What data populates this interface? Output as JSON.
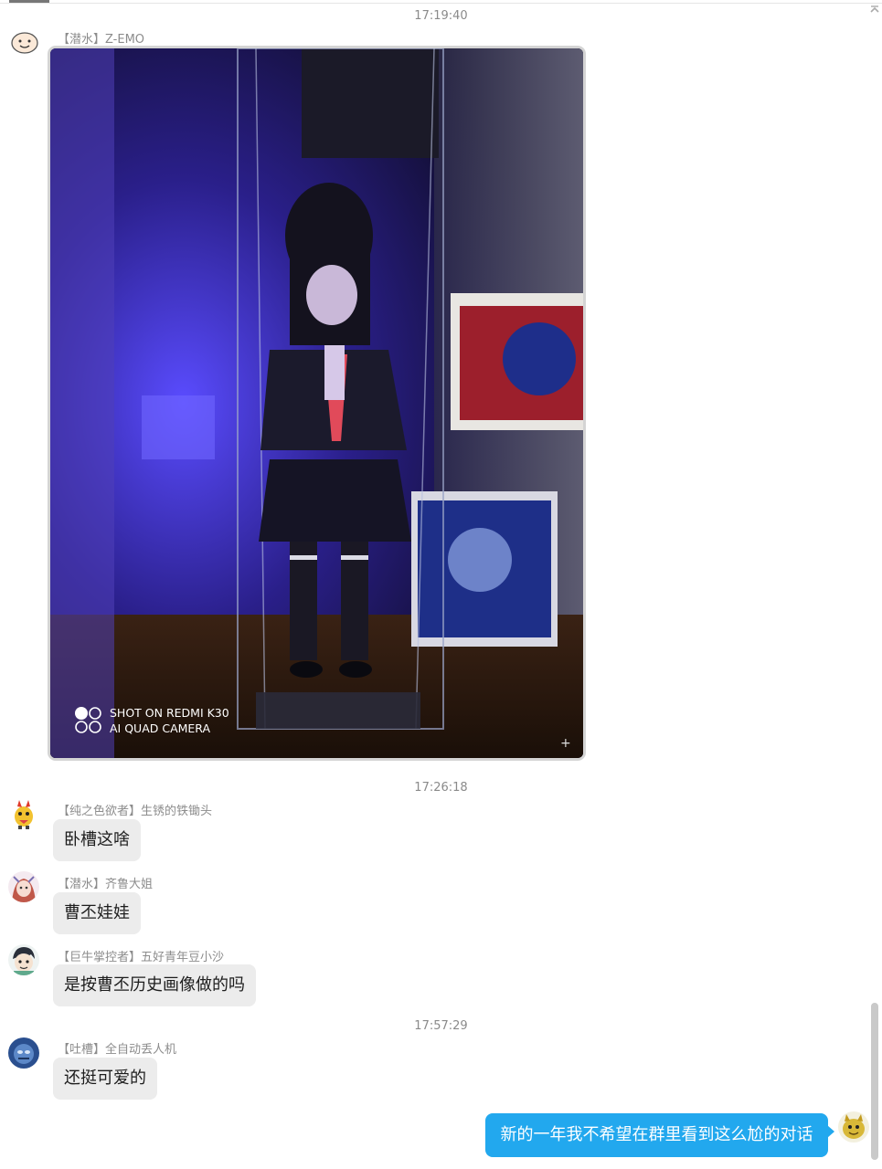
{
  "timestamps": [
    "17:19:40",
    "17:26:18",
    "17:57:29"
  ],
  "messages": [
    {
      "sender": "【潜水】Z-EMO",
      "avatar_icon": "smiley-face-icon"
    },
    {
      "sender": "【纯之色欲者】生锈的铁锄头",
      "text": "卧槽这啥",
      "avatar_icon": "cartoon-bird-avatar-icon"
    },
    {
      "sender": "【潜水】齐鲁大姐",
      "text": "曹丕娃娃",
      "avatar_icon": "anime-girl-avatar-icon"
    },
    {
      "sender": "【巨牛掌控者】五好青年豆小沙",
      "text": "是按曹丕历史画像做的吗",
      "avatar_icon": "cartoon-boy-avatar-icon"
    },
    {
      "sender": "【吐槽】全自动丢人机",
      "text": "还挺可爱的",
      "avatar_icon": "blue-character-avatar-icon"
    }
  ],
  "photo": {
    "watermark_line1": "SHOT ON REDMI K30",
    "watermark_line2": "AI QUAD CAMERA"
  },
  "outgoing": {
    "text": "新的一年我不希望在群里看到这么尬的对话",
    "avatar_icon": "yellow-creature-avatar-icon",
    "bubble_color": "#22a8ee"
  }
}
